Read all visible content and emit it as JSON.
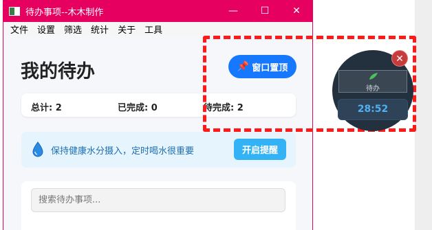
{
  "window": {
    "title": "待办事项--木木制作",
    "controls": {
      "minimize": "—",
      "maximize": "☐",
      "close": "✕"
    }
  },
  "menu": [
    "文件",
    "设置",
    "筛选",
    "统计",
    "关于",
    "工具"
  ],
  "main": {
    "page_title": "我的待办",
    "pin_button": "窗口置顶",
    "stats": {
      "total": "总计: 2",
      "completed": "已完成: 0",
      "pending": "待完成: 2"
    },
    "water": {
      "text": "保持健康水分摄入，定时喝水很重要",
      "button": "开启提醒"
    },
    "search": {
      "placeholder": "搜索待办事项..."
    }
  },
  "widget": {
    "task_label": "待办",
    "timer": "28:52",
    "close": "✕"
  },
  "colors": {
    "titlebar": "#e6005f",
    "primary_button": "#1677ff",
    "remind_button": "#33b2f5",
    "widget_bg": "#23303e",
    "timer_text": "#4fb0f2",
    "highlight_dash": "#ff1a1a"
  }
}
